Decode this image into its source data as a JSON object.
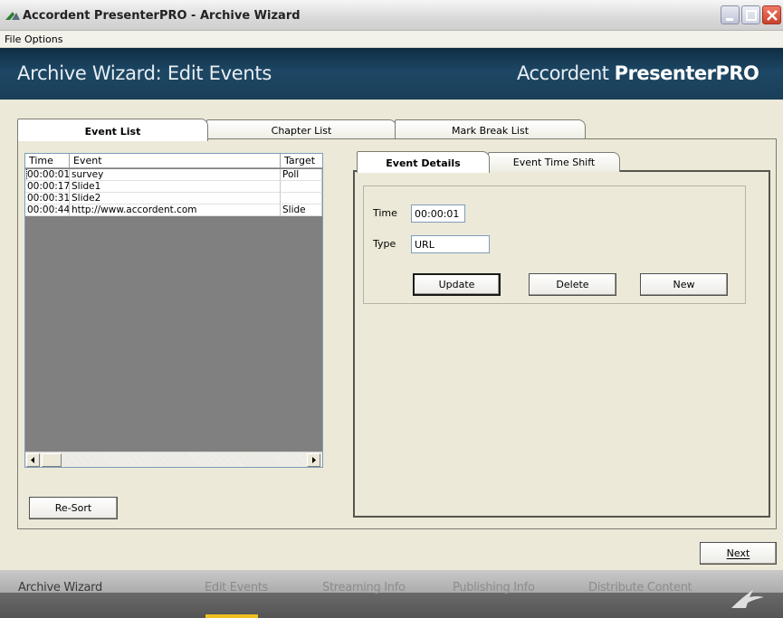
{
  "window": {
    "title": "Accordent PresenterPRO - Archive Wizard"
  },
  "menu": {
    "items": [
      "File",
      "Options"
    ]
  },
  "header": {
    "title": "Archive Wizard: Edit Events",
    "brand_regular": "Accordent ",
    "brand_bold": "PresenterPRO"
  },
  "tabs": [
    {
      "label": "Event List",
      "active": true
    },
    {
      "label": "Chapter List",
      "active": false
    },
    {
      "label": "Mark Break List",
      "active": false
    }
  ],
  "event_list": {
    "columns": [
      "Time",
      "Event",
      "Target"
    ],
    "rows": [
      {
        "time": "00:00:01",
        "event": "survey",
        "target": "Poll"
      },
      {
        "time": "00:00:17",
        "event": "Slide1",
        "target": ""
      },
      {
        "time": "00:00:31",
        "event": "Slide2",
        "target": ""
      },
      {
        "time": "00:00:44",
        "event": "http://www.accordent.com",
        "target": "Slide"
      }
    ],
    "selected_index": 0
  },
  "resort_button": "Re-Sort",
  "inner_tabs": [
    {
      "label": "Event Details",
      "active": true
    },
    {
      "label": "Event Time Shift",
      "active": false
    }
  ],
  "details": {
    "time_label": "Time",
    "time_value": "00:00:01",
    "type_label": "Type",
    "type_value": "URL",
    "update_button": "Update",
    "delete_button": "Delete",
    "new_button": "New"
  },
  "next_button": "Next",
  "wizard_steps": [
    {
      "label": "Archive Wizard",
      "state": "done"
    },
    {
      "label": "Edit Events",
      "state": "current"
    },
    {
      "label": "Streaming Info",
      "state": "pending"
    },
    {
      "label": "Publishing Info",
      "state": "pending"
    },
    {
      "label": "Distribute Content",
      "state": "pending"
    }
  ],
  "colors": {
    "header_bg": "#1d4764",
    "current_step_indicator": "#f2c01e",
    "close_button": "#c8412d"
  }
}
